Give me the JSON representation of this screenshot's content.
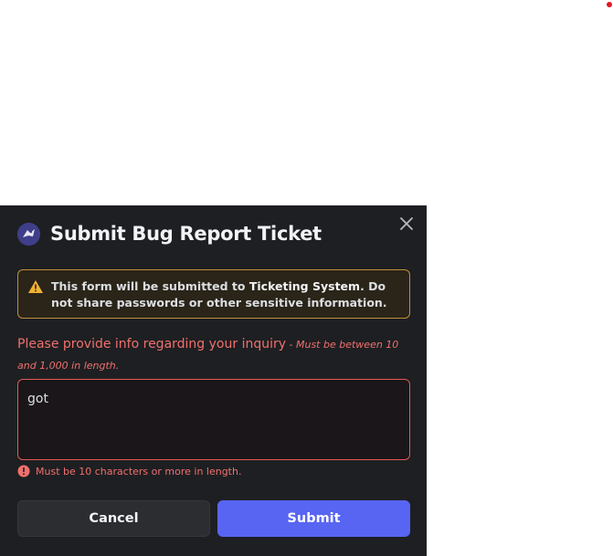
{
  "modal": {
    "title": "Submit Bug Report Ticket",
    "warning": {
      "prefix": "This form will be submitted to ",
      "system_name": "Ticketing System",
      "suffix": ". Do not share passwords or other sensitive information."
    },
    "field": {
      "label": "Please provide info regarding your inquiry",
      "note": " - Must be between 10 and 1,000 in length.",
      "value": "got",
      "error": "Must be 10 characters or more in length."
    },
    "buttons": {
      "cancel": "Cancel",
      "submit": "Submit"
    }
  },
  "colors": {
    "modal_bg": "#1e1f22",
    "warning_border": "#c08e3c",
    "error": "#f0706e",
    "submit": "#5865f2"
  },
  "icons": {
    "app": "app-avatar-icon",
    "close": "close-icon",
    "warning": "warning-triangle-icon",
    "error": "error-circle-icon"
  }
}
